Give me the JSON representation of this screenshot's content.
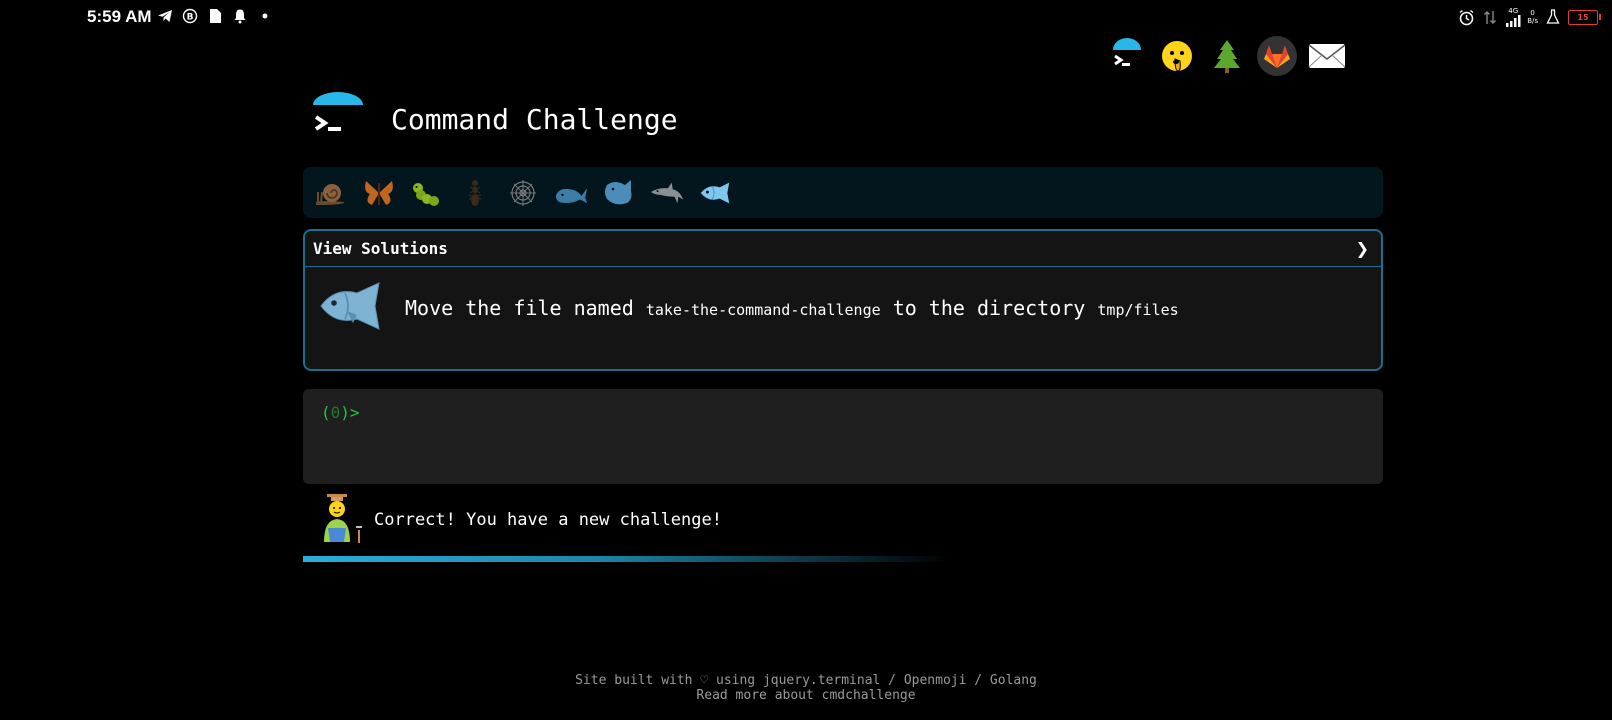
{
  "status_bar": {
    "time": "5:59 AM",
    "left_icons": [
      "telegram-icon",
      "b-badge-icon",
      "document-icon",
      "bell-icon",
      "dot-icon"
    ],
    "network_label": "4G",
    "speed_value": "0",
    "speed_unit": "B/s",
    "battery": "15"
  },
  "top_icons": [
    "terminal-icon",
    "shushing-face-icon",
    "tree-icon",
    "gitlab-icon",
    "mail-icon"
  ],
  "header": {
    "title": "Command Challenge"
  },
  "level_icons": [
    "snail-icon",
    "butterfly-icon",
    "caterpillar-icon",
    "ant-icon",
    "spider-web-icon",
    "whale-icon",
    "shark-icon",
    "dolphin-icon",
    "fish-icon"
  ],
  "challenge": {
    "view_solutions": "View Solutions",
    "chevron": "❯",
    "text_prefix": "Move the file named",
    "file": "take-the-command-challenge",
    "text_middle": "to the directory",
    "directory": "tmp/files"
  },
  "terminal": {
    "prompt_open": "(",
    "prompt_count": "0",
    "prompt_close": ")>"
  },
  "feedback": {
    "text": "Correct! You have a new challenge!"
  },
  "progress": {
    "fraction": 0.6
  },
  "footer": {
    "line1": "Site built with ♡ using jquery.terminal / Openmoji / Golang",
    "line2": "Read more about cmdchallenge"
  },
  "colors": {
    "accent": "#1c6f8c",
    "prompt_green": "#27c43d",
    "level_bar_bg": "#03161d"
  }
}
